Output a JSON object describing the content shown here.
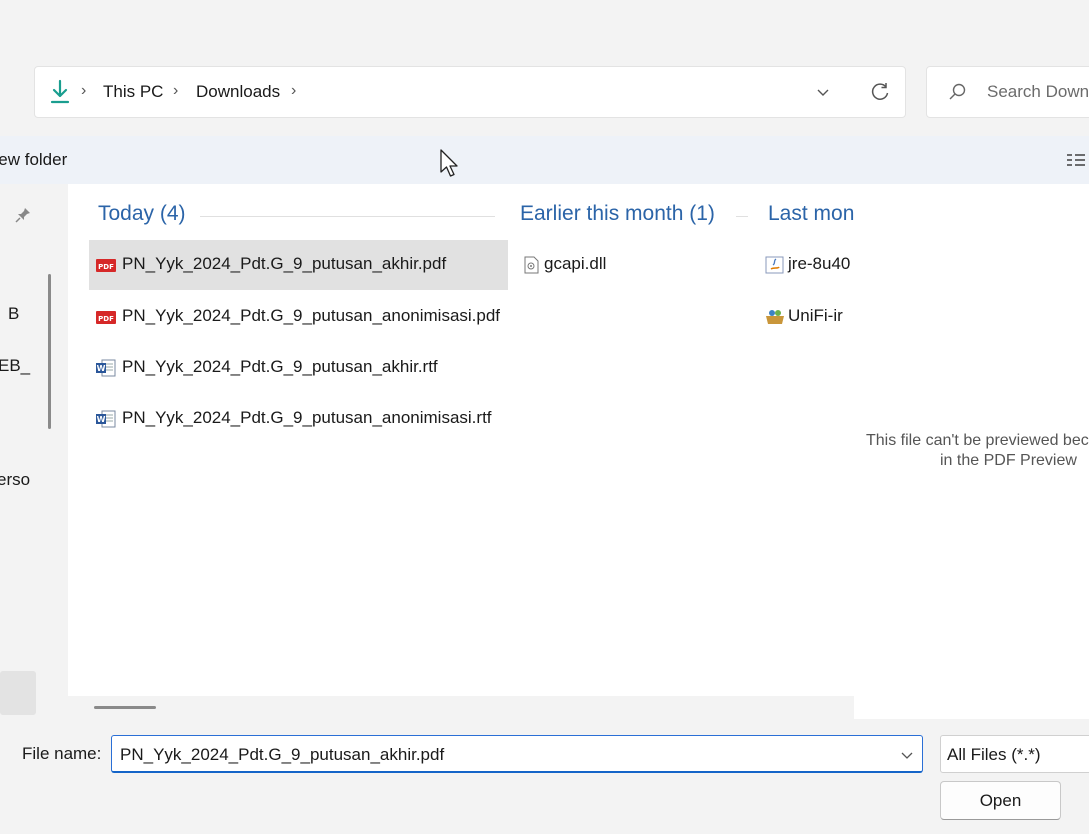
{
  "address_bar": {
    "crumbs": [
      "This PC",
      "Downloads"
    ],
    "separator": "›"
  },
  "search": {
    "placeholder": "Search Downloads"
  },
  "toolbar": {
    "new_folder_label": "New folder"
  },
  "nav_pane": {
    "labels": [
      "B",
      "EB_",
      "erso"
    ]
  },
  "groups": [
    {
      "label": "Today (4)"
    },
    {
      "label": "Earlier this month (1)"
    },
    {
      "label": "Last month"
    }
  ],
  "files": {
    "today": [
      {
        "name": "PN_Yyk_2024_Pdt.G_9_putusan_akhir.pdf",
        "type": "pdf",
        "selected": true
      },
      {
        "name": "PN_Yyk_2024_Pdt.G_9_putusan_anonimisasi.pdf",
        "type": "pdf"
      },
      {
        "name": "PN_Yyk_2024_Pdt.G_9_putusan_akhir.rtf",
        "type": "rtf"
      },
      {
        "name": "PN_Yyk_2024_Pdt.G_9_putusan_anonimisasi.rtf",
        "type": "rtf"
      }
    ],
    "earlier_this_month": [
      {
        "name": "gcapi.dll",
        "type": "dll"
      }
    ],
    "last_month": [
      {
        "name": "jre-8u40",
        "type": "java"
      },
      {
        "name": "UniFi-ir",
        "type": "installer"
      }
    ]
  },
  "preview": {
    "message_line1": "This file can't be previewed because there is no previewer for it in the PDF Preview",
    "message_line2": "in the PDF Preview"
  },
  "file_name": {
    "label": "File name:",
    "value": "PN_Yyk_2024_Pdt.G_9_putusan_akhir.pdf"
  },
  "file_type": {
    "value": "All Files (*.*)"
  },
  "buttons": {
    "open": "Open"
  },
  "colors": {
    "accent": "#1464c8",
    "group_header": "#2b64a8",
    "selection": "#e1e1e1",
    "toolbar_bg": "#eef2f8"
  },
  "icons": [
    "download-icon",
    "chevron-right-icon",
    "chevron-down-icon",
    "refresh-icon",
    "search-icon",
    "view-details-icon",
    "pin-icon",
    "pdf-icon",
    "word-doc-icon",
    "dll-icon",
    "java-icon",
    "installer-icon",
    "mouse-cursor-icon"
  ]
}
